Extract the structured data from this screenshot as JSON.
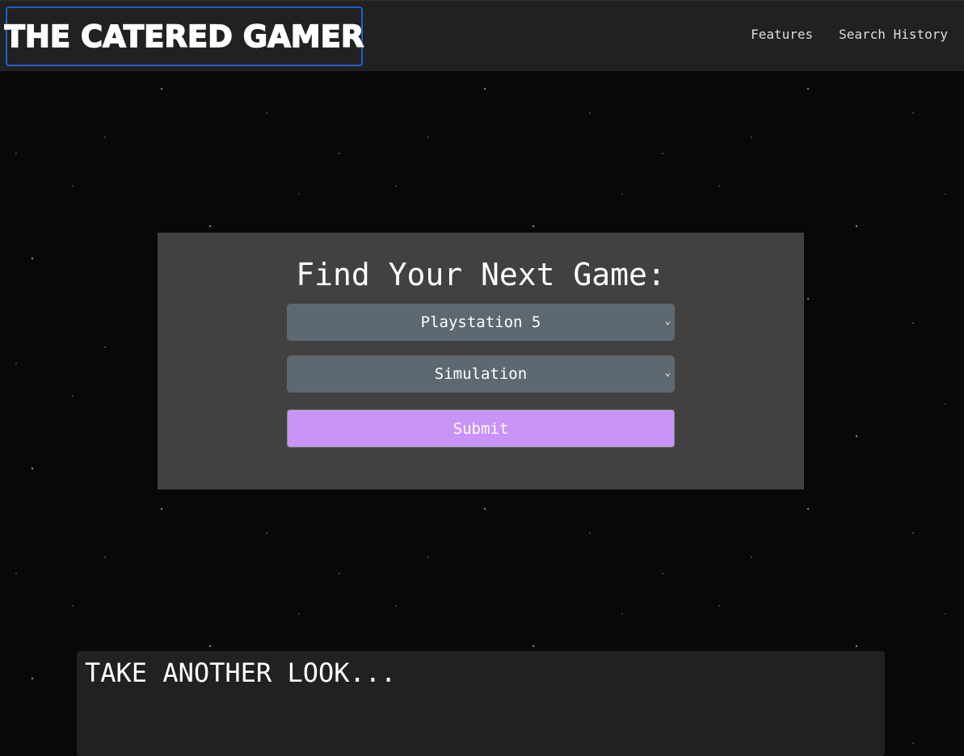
{
  "nav": {
    "brand": "THE CATERED GAMER",
    "links": [
      "Features",
      "Search History"
    ]
  },
  "form": {
    "title": "Find Your Next Game:",
    "platform": "Playstation 5",
    "genre": "Simulation",
    "submit_label": "Submit"
  },
  "section": {
    "title": "TAKE ANOTHER LOOK..."
  },
  "colors": {
    "accent": "#c994f8",
    "select_bg": "#5e6870",
    "card_bg": "#414141",
    "nav_bg": "#212121"
  }
}
